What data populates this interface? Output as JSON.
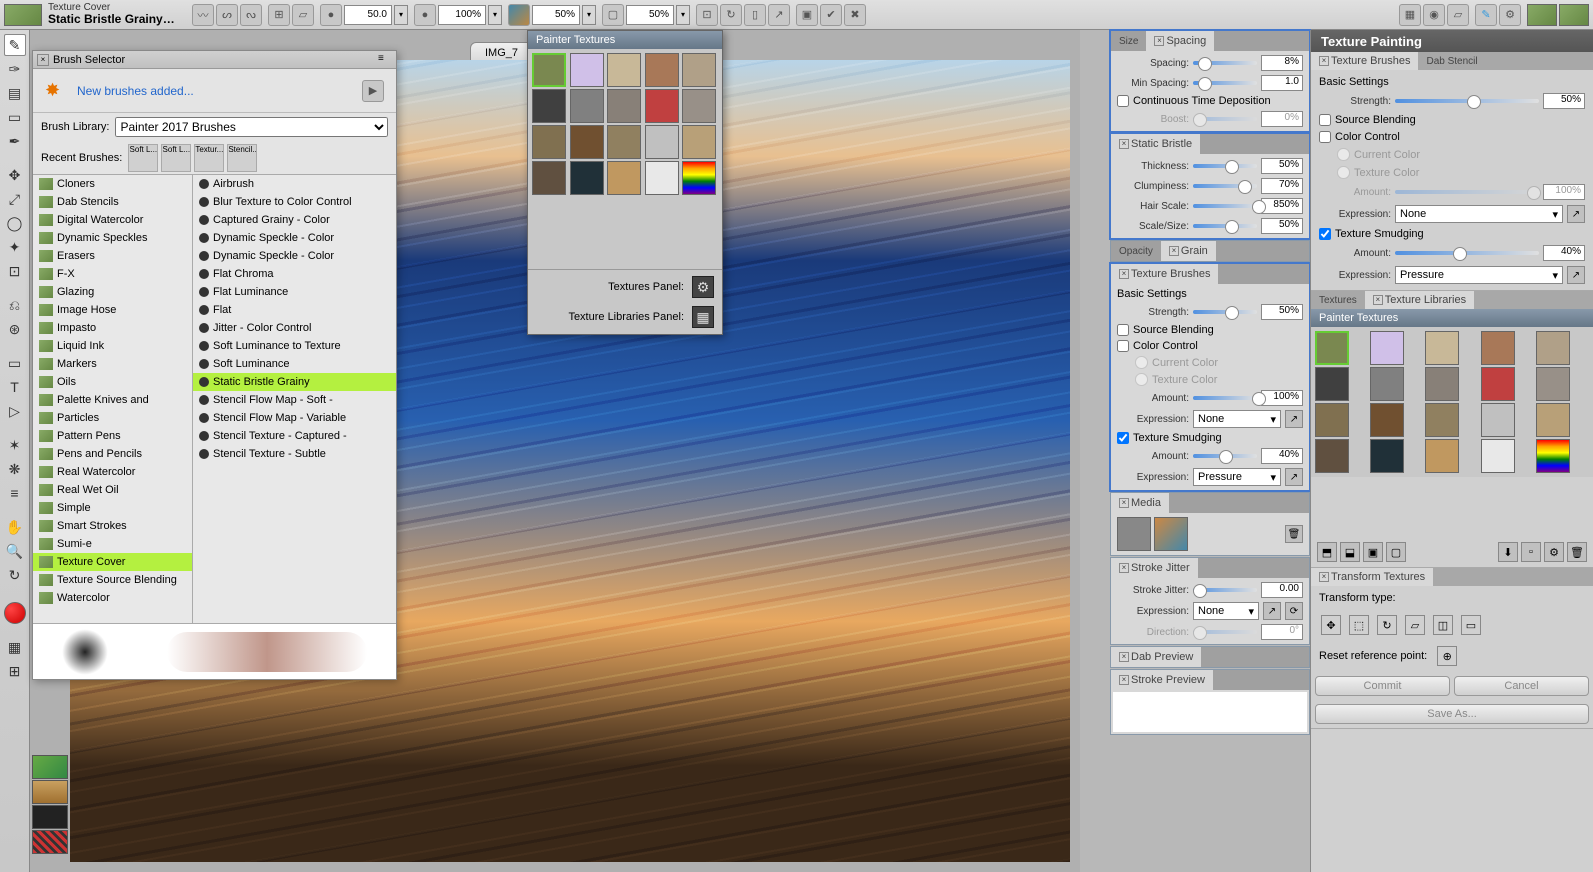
{
  "topbar": {
    "brush_category": "Texture Cover",
    "brush_name": "Static Bristle Grainy L...",
    "size_value": "50.0",
    "opacity_value": "100%",
    "grain_value": "50%",
    "resat_value": "50%"
  },
  "doc_tab": "IMG_7",
  "brush_selector": {
    "title": "Brush Selector",
    "new_brushes": "New brushes added...",
    "lib_label": "Brush Library:",
    "lib_value": "Painter 2017 Brushes",
    "recent_label": "Recent Brushes:",
    "recent": [
      "Soft L...",
      "Soft L...",
      "Textur...",
      "Stencil..."
    ],
    "categories": [
      "Cloners",
      "Dab Stencils",
      "Digital Watercolor",
      "Dynamic Speckles",
      "Erasers",
      "F-X",
      "Glazing",
      "Image Hose",
      "Impasto",
      "Liquid Ink",
      "Markers",
      "Oils",
      "Palette Knives and",
      "Particles",
      "Pattern Pens",
      "Pens and Pencils",
      "Real Watercolor",
      "Real Wet Oil",
      "Simple",
      "Smart Strokes",
      "Sumi-e",
      "Texture Cover",
      "Texture Source Blending",
      "Watercolor"
    ],
    "category_selected": "Texture Cover",
    "variants": [
      "Airbrush",
      "Blur Texture to Color Control",
      "Captured Grainy - Color",
      "Dynamic Speckle - Color",
      "Dynamic Speckle - Color",
      "Flat Chroma",
      "Flat Luminance",
      "Flat",
      "Jitter - Color Control",
      "Soft Luminance to Texture",
      "Soft Luminance",
      "Static Bristle Grainy",
      "Stencil Flow Map - Soft -",
      "Stencil Flow Map - Variable",
      "Stencil Texture - Captured -",
      "Stencil Texture - Subtle"
    ],
    "variant_selected": "Static Bristle Grainy"
  },
  "tex_drop": {
    "title": "Painter Textures",
    "textures_panel": "Textures Panel:",
    "libraries_panel": "Texture Libraries Panel:"
  },
  "panels": {
    "spacing": {
      "tab1": "Size",
      "tab2": "Spacing",
      "spacing_label": "Spacing:",
      "spacing_val": "8%",
      "minspacing_label": "Min Spacing:",
      "minspacing_val": "1.0",
      "ctd": "Continuous Time Deposition",
      "boost_label": "Boost:",
      "boost_val": "0%"
    },
    "static_bristle": {
      "title": "Static Bristle",
      "thickness_label": "Thickness:",
      "thickness_val": "50%",
      "clump_label": "Clumpiness:",
      "clump_val": "70%",
      "hair_label": "Hair Scale:",
      "hair_val": "850%",
      "scale_label": "Scale/Size:",
      "scale_val": "50%"
    },
    "grain": {
      "tab1": "Opacity",
      "tab2": "Grain"
    },
    "tex_brushes": {
      "title": "Texture Brushes",
      "basic": "Basic Settings",
      "strength_label": "Strength:",
      "strength_val": "50%",
      "src_blend": "Source Blending",
      "color_ctrl": "Color Control",
      "current_color": "Current Color",
      "texture_color": "Texture Color",
      "amount_label": "Amount:",
      "amount_val": "100%",
      "expr_label": "Expression:",
      "expr_val": "None",
      "smudge": "Texture Smudging",
      "smudge_amount_label": "Amount:",
      "smudge_amount_val": "40%",
      "smudge_expr_label": "Expression:",
      "smudge_expr_val": "Pressure"
    },
    "media": {
      "title": "Media"
    },
    "stroke_jitter": {
      "title": "Stroke Jitter",
      "sj_label": "Stroke Jitter:",
      "sj_val": "0.00",
      "expr_label": "Expression:",
      "expr_val": "None",
      "dir_label": "Direction:",
      "dir_val": "0°"
    },
    "dab_preview": {
      "title": "Dab Preview"
    },
    "stroke_preview": {
      "title": "Stroke Preview"
    }
  },
  "texpaint": {
    "title": "Texture Painting",
    "tabs1": {
      "a": "Texture Brushes",
      "b": "Dab Stencil"
    },
    "basic": "Basic Settings",
    "strength_label": "Strength:",
    "strength_val": "50%",
    "src_blend": "Source Blending",
    "color_ctrl": "Color Control",
    "current_color": "Current Color",
    "texture_color": "Texture Color",
    "amount_label": "Amount:",
    "amount_val": "100%",
    "expr_label": "Expression:",
    "expr_val": "None",
    "smudge": "Texture Smudging",
    "s_amount_label": "Amount:",
    "s_amount_val": "40%",
    "s_expr_label": "Expression:",
    "s_expr_val": "Pressure",
    "tabs2": {
      "a": "Textures",
      "b": "Texture Libraries"
    },
    "lib_title": "Painter Textures",
    "transform": {
      "title": "Transform Textures",
      "type_label": "Transform type:",
      "reset_label": "Reset reference point:"
    },
    "commit": "Commit",
    "cancel": "Cancel",
    "saveas": "Save As..."
  },
  "texture_colors": [
    "#7a8850",
    "#d0c0e8",
    "#c8b898",
    "#a87858",
    "#b0a088",
    "#404040",
    "#808080",
    "#888078",
    "#c04040",
    "#989088",
    "#807050",
    "#705030",
    "#908060",
    "#c0c0c0",
    "#b8a078",
    "#605040",
    "#203038",
    "#c09860",
    "#e8e8e8",
    "linear-gradient(180deg,red,orange,yellow,green,blue,purple)"
  ]
}
